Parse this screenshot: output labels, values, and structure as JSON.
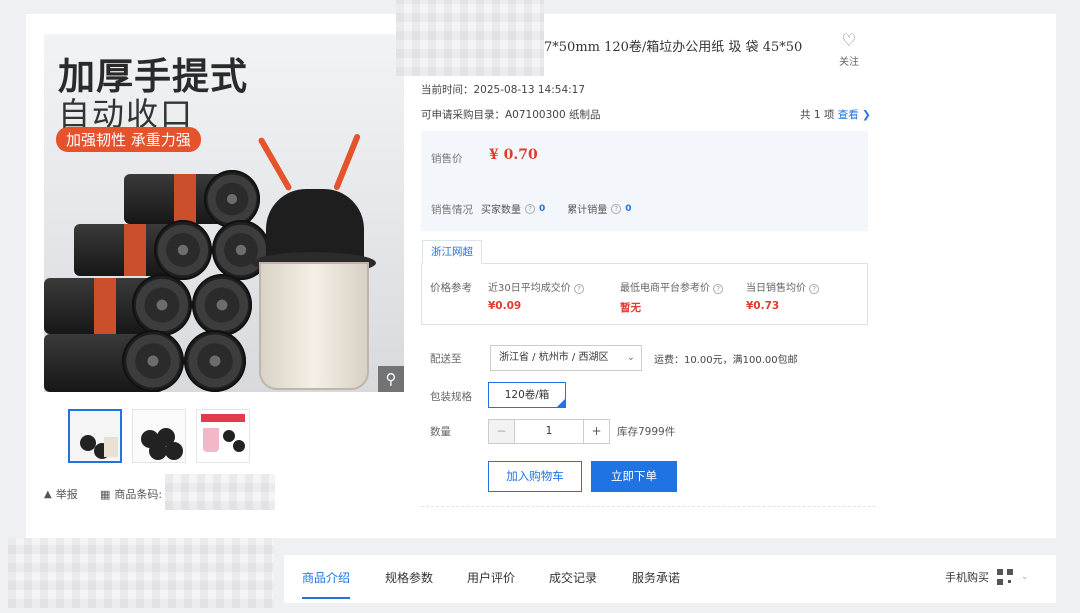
{
  "product": {
    "title_visible": "7*50mm 120卷/箱垃办公用纸 圾 袋 45*50",
    "favorite_label": "关注",
    "current_time_label": "当前时间：",
    "current_time": "2025-08-13 14:54:17",
    "catalog_label": "可申请采购目录：",
    "catalog_value": "A07100300 纸制品",
    "catalog_count": "共 1 项",
    "catalog_link": "查看",
    "gallery": {
      "title1": "加厚手提式",
      "title2": "自动收口",
      "badge": "加强韧性 承重力强"
    },
    "report_label": "举报",
    "barcode_label": "商品条码:"
  },
  "price": {
    "label": "销售价",
    "value": "¥ 0.70",
    "sales_label": "销售情况",
    "buyers_label": "买家数量",
    "buyers_value": "0",
    "total_sales_label": "累计销量",
    "total_sales_value": "0"
  },
  "reference": {
    "tab": "浙江网超",
    "label": "价格参考",
    "cols": [
      {
        "label": "近30日平均成交价",
        "value": "¥0.09"
      },
      {
        "label": "最低电商平台参考价",
        "value": "暂无"
      },
      {
        "label": "当日销售均价",
        "value": "¥0.73"
      }
    ]
  },
  "delivery": {
    "label": "配送至",
    "region": "浙江省 / 杭州市 / 西湖区",
    "freight": "运费：10.00元，满100.00包邮"
  },
  "spec": {
    "label": "包装规格",
    "option": "120卷/箱"
  },
  "quantity": {
    "label": "数量",
    "minus": "−",
    "value": "1",
    "plus": "+",
    "stock": "库存7999件"
  },
  "actions": {
    "add_to_cart": "加入购物车",
    "buy_now": "立即下单"
  },
  "tabs": [
    "商品介绍",
    "规格参数",
    "用户评价",
    "成交记录",
    "服务承诺"
  ],
  "mobile_buy": "手机购买",
  "colors": {
    "accent": "#1f73e3",
    "price": "#e23b2e"
  }
}
